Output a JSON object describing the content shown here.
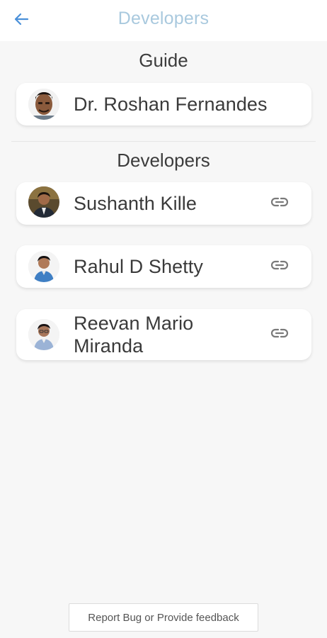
{
  "appbar": {
    "title": "Developers",
    "back_icon": "arrow-left-icon",
    "back_color": "#4a90d9",
    "title_color": "#a9c9de"
  },
  "guide_section": {
    "heading": "Guide",
    "guide": {
      "name": "Dr. Roshan Fernandes",
      "avatar_icon": "person-photo-avatar"
    }
  },
  "developers_section": {
    "heading": "Developers",
    "developers": [
      {
        "name": "Sushanth Kille",
        "avatar_icon": "person-photo-avatar",
        "link_icon": "link-icon"
      },
      {
        "name": "Rahul D Shetty",
        "avatar_icon": "person-photo-avatar",
        "link_icon": "link-icon"
      },
      {
        "name_line1": "Reevan Mario",
        "name_line2": "Miranda",
        "avatar_icon": "person-photo-avatar",
        "link_icon": "link-icon"
      }
    ]
  },
  "footer": {
    "feedback_label": "Report Bug or Provide feedback"
  }
}
